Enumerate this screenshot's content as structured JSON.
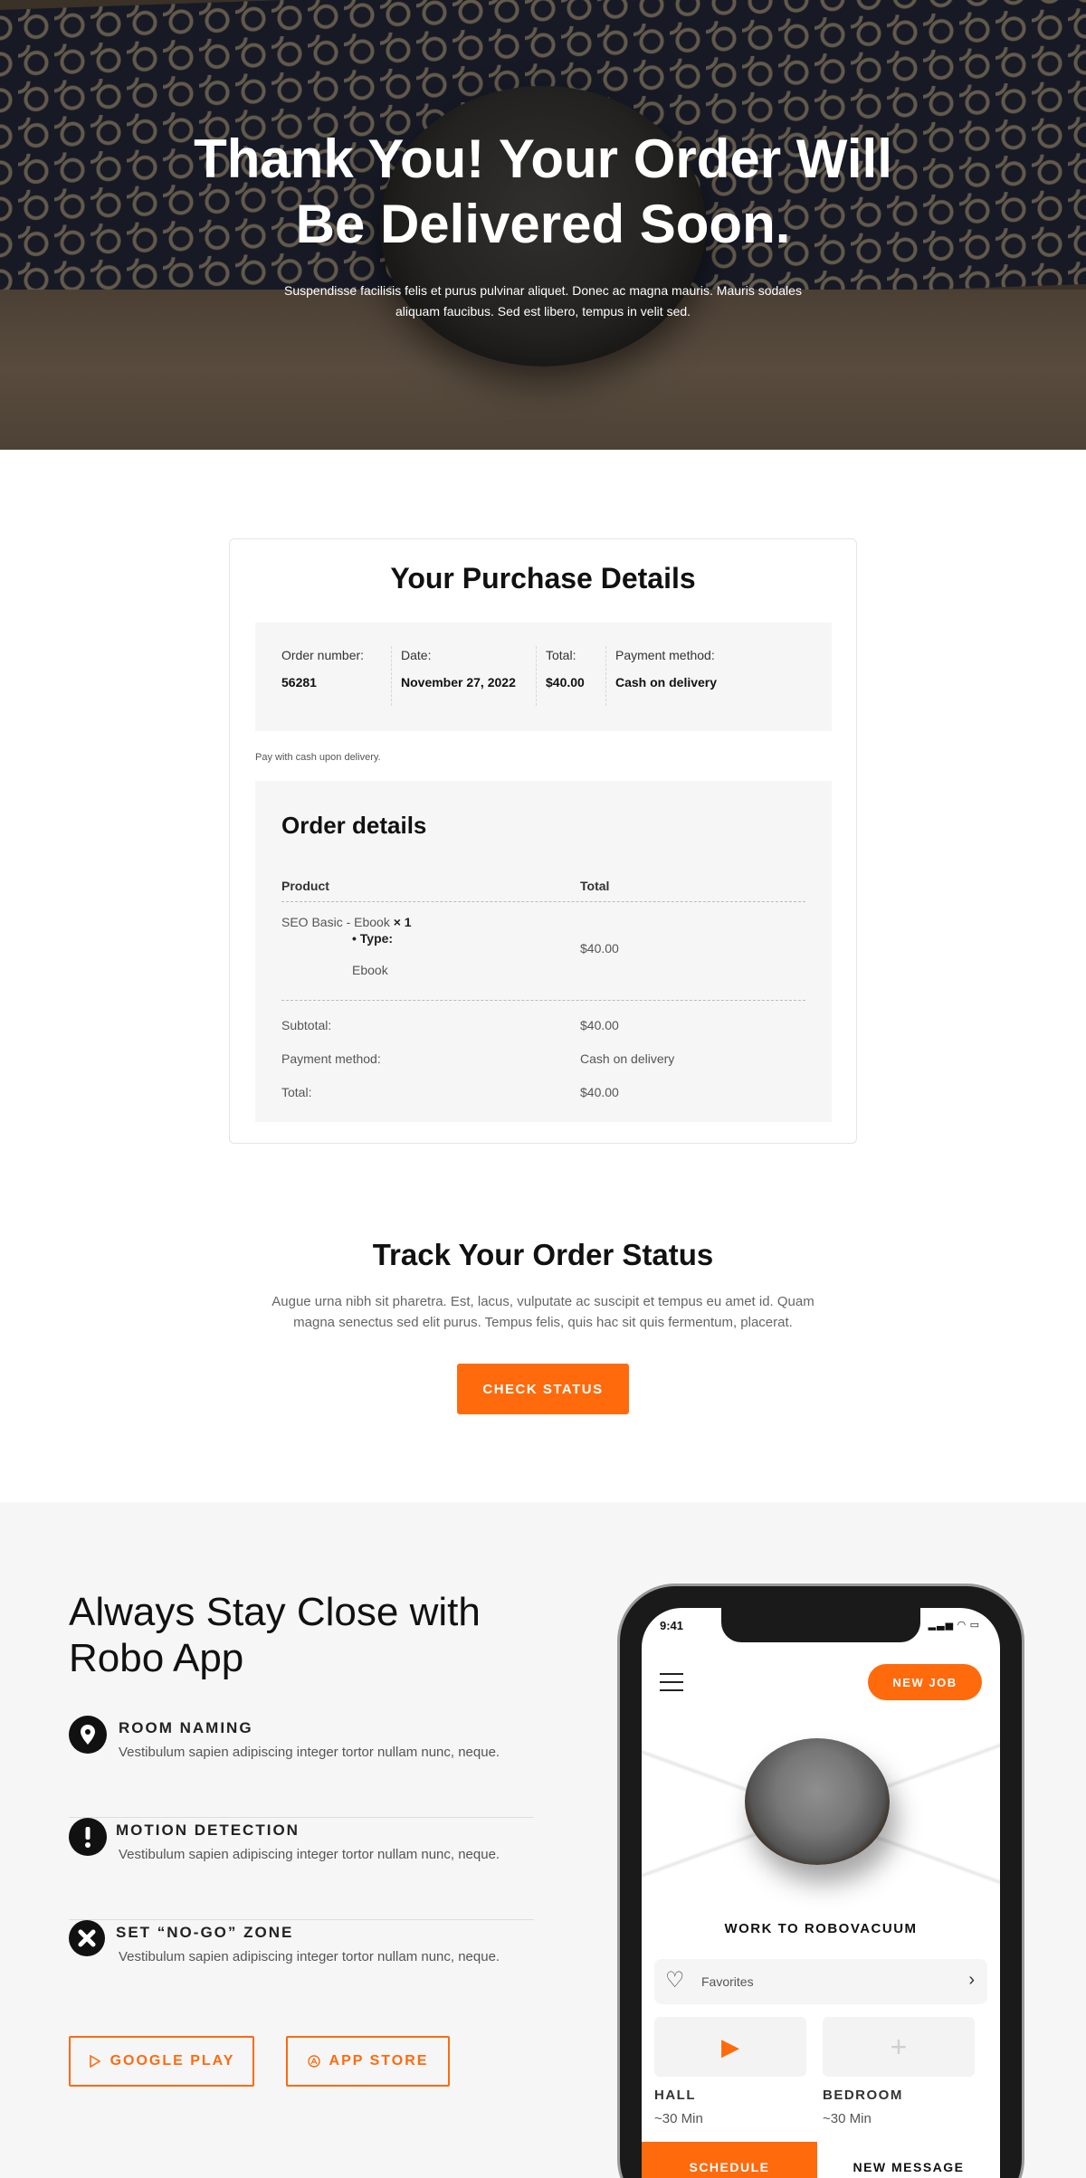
{
  "hero": {
    "title_line1": "Thank You! Your Order Will",
    "title_line2": "Be Delivered Soon.",
    "subtitle_line1": "Suspendisse facilisis felis et purus pulvinar aliquet. Donec ac magna mauris. Mauris sodales",
    "subtitle_line2": "aliquam faucibus. Sed est libero, tempus in velit sed."
  },
  "purchase": {
    "title": "Your Purchase Details",
    "order_number_label": "Order number:",
    "order_number": "56281",
    "date_label": "Date:",
    "date": "November 27, 2022",
    "total_label": "Total:",
    "total": "$40.00",
    "payment_label": "Payment method:",
    "payment": "Cash on delivery",
    "note": "Pay with cash upon delivery."
  },
  "order_details": {
    "title": "Order details",
    "col_product": "Product",
    "col_total": "Total",
    "item_name": "SEO Basic - Ebook",
    "item_qty": "× 1",
    "item_meta_label": "Type:",
    "item_meta_value": "Ebook",
    "item_total": "$40.00",
    "subtotal_label": "Subtotal:",
    "subtotal": "$40.00",
    "payment_label": "Payment method:",
    "payment": "Cash on delivery",
    "total_label": "Total:",
    "total": "$40.00"
  },
  "track": {
    "title": "Track Your Order Status",
    "text_line1": "Augue urna nibh sit pharetra. Est, lacus, vulputate ac suscipit et tempus eu amet id. Quam",
    "text_line2": "magna senectus sed elit purus. Tempus felis, quis hac sit quis fermentum, placerat.",
    "button": "CHECK STATUS"
  },
  "app": {
    "title_line1": "Always Stay Close with",
    "title_line2": "Robo App",
    "features": [
      {
        "title": "ROOM NAMING",
        "text": "Vestibulum sapien adipiscing integer tortor nullam nunc, neque.",
        "icon": "map-pin-icon"
      },
      {
        "title": "MOTION DETECTION",
        "text": "Vestibulum sapien adipiscing integer tortor nullam nunc, neque.",
        "icon": "exclamation-icon"
      },
      {
        "title": "SET “NO-GO” ZONE",
        "text": "Vestibulum sapien adipiscing integer tortor nullam nunc, neque.",
        "icon": "x-icon"
      }
    ],
    "google_play": "GOOGLE PLAY",
    "app_store": "APP STORE"
  },
  "phone": {
    "time": "9:41",
    "new_job": "NEW JOB",
    "work_title": "WORK TO ROBOVACUUM",
    "favorites": "Favorites",
    "tile1_label": "HALL",
    "tile1_sub": "~30 Min",
    "tile2_label": "BEDROOM",
    "tile2_sub": "~30 Min",
    "tab_schedule": "SCHEDULE",
    "tab_message": "NEW MESSAGE"
  },
  "colors": {
    "accent": "#ff6a0d",
    "panel": "#f6f6f6",
    "text": "#111111"
  }
}
